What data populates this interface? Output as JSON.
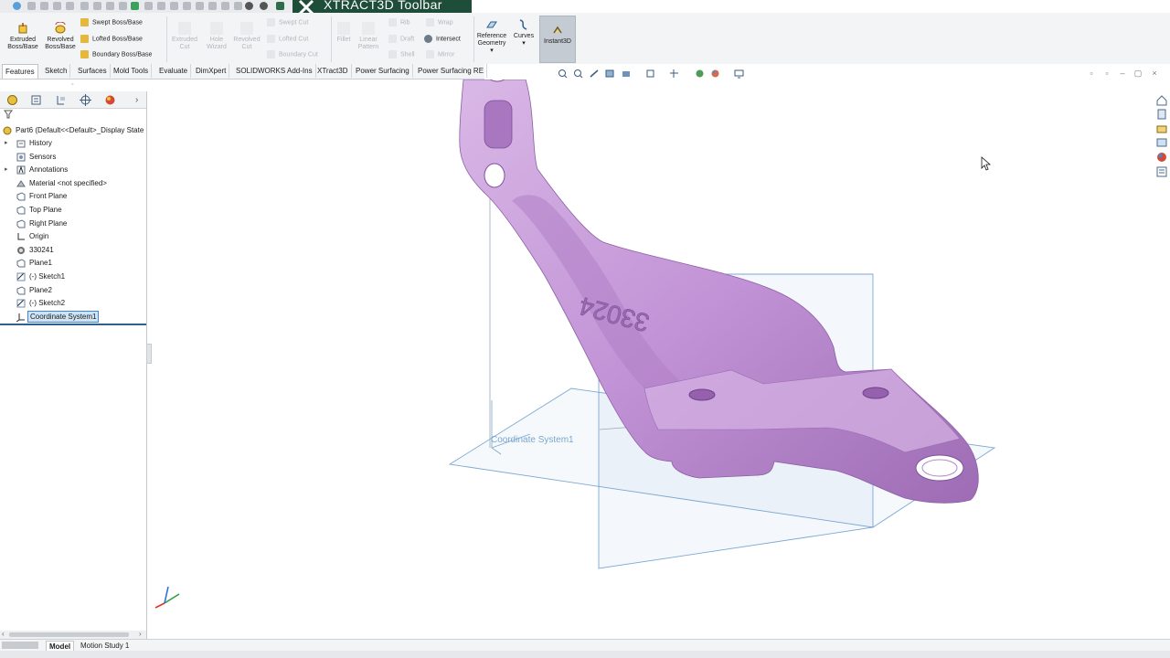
{
  "xtract3d": {
    "title": "XTRACT3D Toolbar"
  },
  "ribbon": {
    "extruded_boss": "Extruded Boss/Base",
    "revolved_boss": "Revolved Boss/Base",
    "swept_boss": "Swept Boss/Base",
    "lofted_boss": "Lofted Boss/Base",
    "boundary_boss": "Boundary Boss/Base",
    "extruded_cut": "Extruded Cut",
    "hole_wizard": "Hole Wizard",
    "revolved_cut": "Revolved Cut",
    "swept_cut": "Swept Cut",
    "lofted_cut": "Lofted Cut",
    "boundary_cut": "Boundary Cut",
    "fillet": "Fillet",
    "linear_pattern": "Linear Pattern",
    "rib": "Rib",
    "draft": "Draft",
    "shell": "Shell",
    "wrap": "Wrap",
    "intersect": "Intersect",
    "mirror": "Mirror",
    "reference_geometry": "Reference Geometry",
    "curves": "Curves",
    "instant3d": "Instant3D"
  },
  "tabs": [
    "Features",
    "Sketch",
    "Surfaces",
    "Mold Tools",
    "Evaluate",
    "DimXpert",
    "SOLIDWORKS Add-Ins",
    "XTract3D",
    "Power Surfacing",
    "Power Surfacing RE"
  ],
  "tree": {
    "part": "Part6  (Default<<Default>_Display State",
    "items": [
      {
        "label": "History",
        "icon": "history-folder-icon"
      },
      {
        "label": "Sensors",
        "icon": "sensors-icon"
      },
      {
        "label": "Annotations",
        "icon": "annotations-icon"
      },
      {
        "label": "Material <not specified>",
        "icon": "material-icon"
      },
      {
        "label": "Front Plane",
        "icon": "plane-icon"
      },
      {
        "label": "Top Plane",
        "icon": "plane-icon"
      },
      {
        "label": "Right Plane",
        "icon": "plane-icon"
      },
      {
        "label": "Origin",
        "icon": "origin-icon"
      },
      {
        "label": "330241",
        "icon": "mesh-body-icon"
      },
      {
        "label": "Plane1",
        "icon": "plane-icon"
      },
      {
        "label": "(-) Sketch1",
        "icon": "sketch-icon"
      },
      {
        "label": "Plane2",
        "icon": "plane-icon"
      },
      {
        "label": "(-) Sketch2",
        "icon": "sketch-icon"
      },
      {
        "label": "Coordinate System1",
        "icon": "coordinate-system-icon"
      }
    ]
  },
  "viewport": {
    "part_engraving": "33024",
    "coord_label": "Coordinate System1",
    "part_color": "#c79bd9",
    "plane_color": "#5f93c9"
  },
  "bottom_tabs": {
    "model": "Model",
    "motion": "Motion Study 1"
  }
}
